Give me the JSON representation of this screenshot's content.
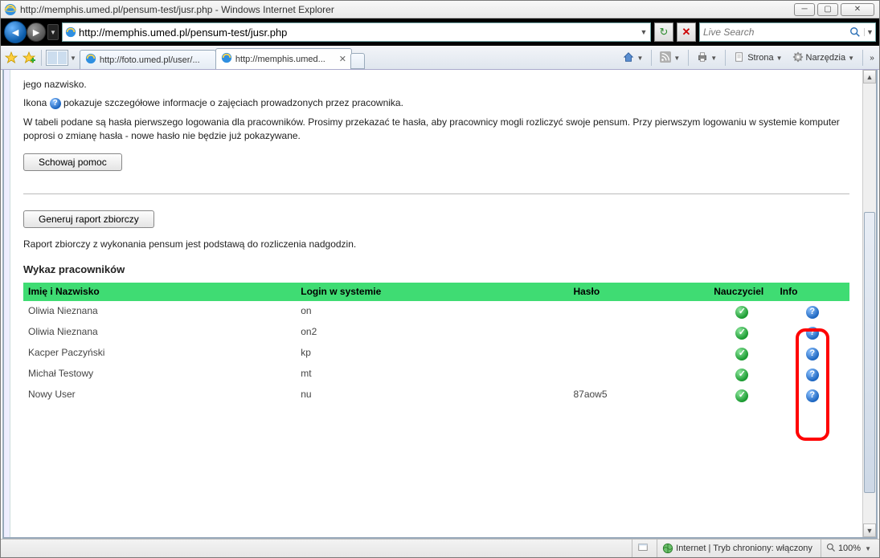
{
  "window": {
    "title": "http://memphis.umed.pl/pensum-test/jusr.php - Windows Internet Explorer"
  },
  "address_bar": {
    "url": "http://memphis.umed.pl/pensum-test/jusr.php"
  },
  "search": {
    "placeholder": "Live Search"
  },
  "tabs": [
    {
      "label": "http://foto.umed.pl/user/...",
      "active": false
    },
    {
      "label": "http://memphis.umed...",
      "active": true
    }
  ],
  "toolbar": {
    "page_label": "Strona",
    "tools_label": "Narzędzia"
  },
  "page": {
    "fragment_line1": "jego nazwisko.",
    "icon_sentence_before": "Ikona ",
    "icon_sentence_after": " pokazuje szczegółowe informacje o zajęciach prowadzonych przez pracownika.",
    "paragraph_passwords": "W tabeli podane są hasła pierwszego logowania dla pracowników. Prosimy przekazać te hasła, aby pracownicy mogli rozliczyć swoje pensum. Przy pierwszym logowaniu w systemie komputer poprosi o zmianę hasła - nowe hasło nie będzie już pokazywane.",
    "hide_help_btn": "Schowaj pomoc",
    "generate_report_btn": "Generuj raport zbiorczy",
    "report_note": "Raport zbiorczy z wykonania pensum jest podstawą do rozliczenia nadgodzin.",
    "list_heading": "Wykaz pracowników",
    "columns": {
      "name": "Imię i Nazwisko",
      "login": "Login w systemie",
      "password": "Hasło",
      "teacher": "Nauczyciel",
      "info": "Info"
    },
    "rows": [
      {
        "name": "Oliwia Nieznana",
        "login": "on",
        "password": "",
        "teacher": true
      },
      {
        "name": "Oliwia Nieznana",
        "login": "on2",
        "password": "",
        "teacher": true
      },
      {
        "name": "Kacper Paczyński",
        "login": "kp",
        "password": "",
        "teacher": true
      },
      {
        "name": "Michał Testowy",
        "login": "mt",
        "password": "",
        "teacher": true
      },
      {
        "name": "Nowy User",
        "login": "nu",
        "password": "87aow5",
        "teacher": true
      }
    ]
  },
  "status": {
    "zone_text": "Internet | Tryb chroniony: włączony",
    "zoom": "100%"
  }
}
